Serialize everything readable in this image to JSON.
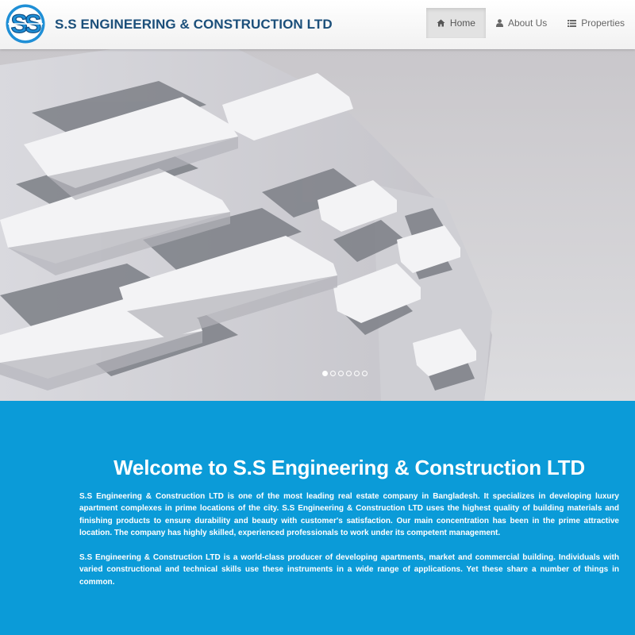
{
  "header": {
    "logo_text": "SS",
    "brand": "S.S ENGINEERING & CONSTRUCTION LTD",
    "nav": [
      {
        "label": "Home",
        "icon": "home-icon",
        "active": true
      },
      {
        "label": "About Us",
        "icon": "user-icon",
        "active": false
      },
      {
        "label": "Properties",
        "icon": "list-icon",
        "active": false
      }
    ]
  },
  "hero": {
    "image": "white-modern-apartment-building-photo",
    "slides": 6,
    "active_slide": 1
  },
  "welcome": {
    "title": "Welcome to S.S Engineering & Construction LTD",
    "paragraph1": "S.S Engineering & Construction LTD is one of the most leading real estate company in Bangladesh. It specializes in developing luxury apartment complexes in prime locations of the city. S.S Engineering & Construction LTD uses the highest quality of building materials and finishing products to ensure durability and beauty with customer's satisfaction. Our main concentration has been in the prime attractive location. The company has highly skilled, experienced professionals to work under its competent management.",
    "paragraph2": "S.S Engineering & Construction LTD is a world-class producer of developing apartments, market and commercial building. Individuals with varied constructional and technical skills use these instruments in a wide range of applications. Yet these share a number of things in common."
  },
  "colors": {
    "brand_text": "#1b4f7a",
    "logo_blue": "#1f8fd6",
    "welcome_bg": "#0b9bd8",
    "nav_active_bg": "#e2e2e2"
  }
}
